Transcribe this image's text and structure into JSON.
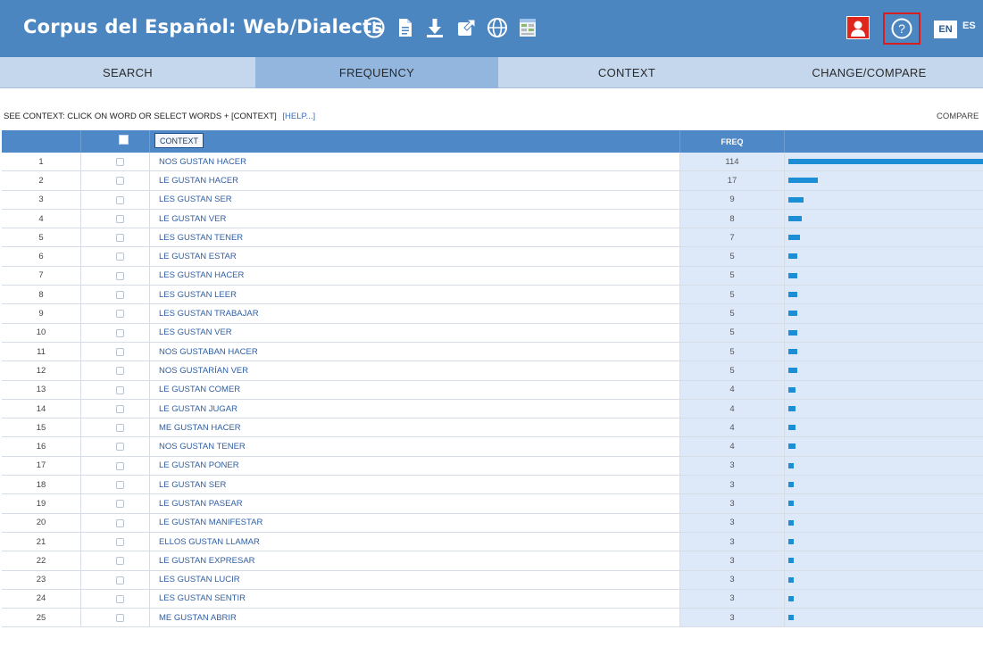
{
  "header": {
    "title": "Corpus del Español: Web/Dialects",
    "icons": [
      "info-icon",
      "document-icon",
      "download-icon",
      "external-link-icon",
      "globe-icon",
      "texts-icon"
    ],
    "right_icons": [
      "user-icon",
      "help-icon"
    ],
    "lang_en": "EN",
    "lang_es": "ES"
  },
  "tabs": [
    {
      "label": "SEARCH",
      "active": false
    },
    {
      "label": "FREQUENCY",
      "active": true
    },
    {
      "label": "CONTEXT",
      "active": false
    },
    {
      "label": "CHANGE/COMPARE",
      "active": false
    }
  ],
  "instructions": {
    "text": "SEE CONTEXT: CLICK ON WORD OR SELECT WORDS + [CONTEXT]",
    "help_link": "[HELP...]",
    "compare_link": "COMPARE"
  },
  "table": {
    "context_button": "CONTEXT",
    "freq_header": "FREQ",
    "rows": [
      {
        "rank": "1",
        "word": "NOS GUSTAN HACER",
        "freq": "114"
      },
      {
        "rank": "2",
        "word": "LE GUSTAN HACER",
        "freq": "17"
      },
      {
        "rank": "3",
        "word": "LES GUSTAN SER",
        "freq": "9"
      },
      {
        "rank": "4",
        "word": "LE GUSTAN VER",
        "freq": "8"
      },
      {
        "rank": "5",
        "word": "LES GUSTAN TENER",
        "freq": "7"
      },
      {
        "rank": "6",
        "word": "LE GUSTAN ESTAR",
        "freq": "5"
      },
      {
        "rank": "7",
        "word": "LES GUSTAN HACER",
        "freq": "5"
      },
      {
        "rank": "8",
        "word": "LES GUSTAN LEER",
        "freq": "5"
      },
      {
        "rank": "9",
        "word": "LES GUSTAN TRABAJAR",
        "freq": "5"
      },
      {
        "rank": "10",
        "word": "LES GUSTAN VER",
        "freq": "5"
      },
      {
        "rank": "11",
        "word": "NOS GUSTABAN HACER",
        "freq": "5"
      },
      {
        "rank": "12",
        "word": "NOS GUSTARÍAN VER",
        "freq": "5"
      },
      {
        "rank": "13",
        "word": "LE GUSTAN COMER",
        "freq": "4"
      },
      {
        "rank": "14",
        "word": "LE GUSTAN JUGAR",
        "freq": "4"
      },
      {
        "rank": "15",
        "word": "ME GUSTAN HACER",
        "freq": "4"
      },
      {
        "rank": "16",
        "word": "NOS GUSTAN TENER",
        "freq": "4"
      },
      {
        "rank": "17",
        "word": "LE GUSTAN PONER",
        "freq": "3"
      },
      {
        "rank": "18",
        "word": "LE GUSTAN SER",
        "freq": "3"
      },
      {
        "rank": "19",
        "word": "LE GUSTAN PASEAR",
        "freq": "3"
      },
      {
        "rank": "20",
        "word": "LE GUSTAN MANIFESTAR",
        "freq": "3"
      },
      {
        "rank": "21",
        "word": "ELLOS GUSTAN LLAMAR",
        "freq": "3"
      },
      {
        "rank": "22",
        "word": "LE GUSTAN EXPRESAR",
        "freq": "3"
      },
      {
        "rank": "23",
        "word": "LES GUSTAN LUCIR",
        "freq": "3"
      },
      {
        "rank": "24",
        "word": "LES GUSTAN SENTIR",
        "freq": "3"
      },
      {
        "rank": "25",
        "word": "ME GUSTAN ABRIR",
        "freq": "3"
      }
    ]
  },
  "colors": {
    "header_bg": "#4c86c1",
    "tab_bg": "#c5d7ec",
    "tab_active_bg": "#92b6de",
    "freq_bg": "#dde8f8",
    "bar": "#1b8ed6",
    "link": "#2f5fa3"
  }
}
